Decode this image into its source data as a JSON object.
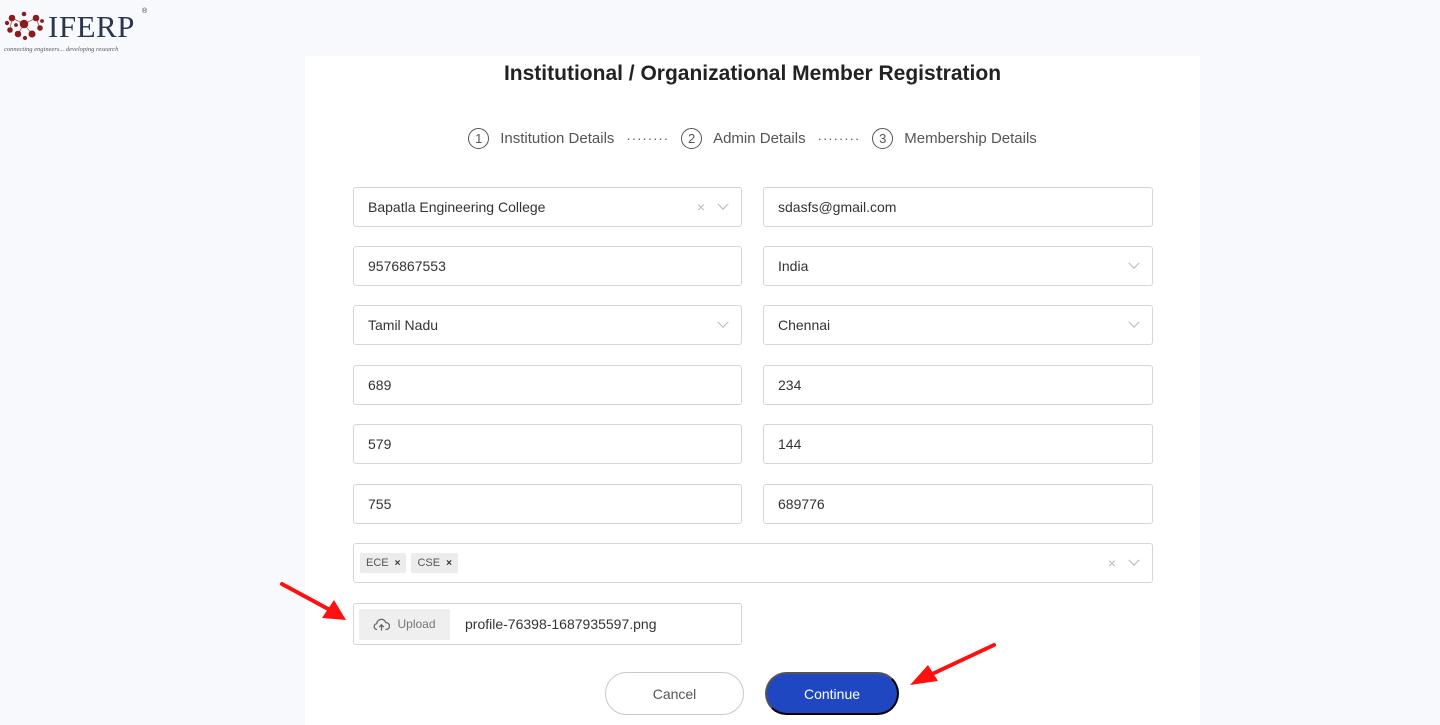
{
  "brand": {
    "name": "IFERP",
    "tagline": "connecting engineers... developing research",
    "registered_mark": "®",
    "colors": {
      "logo_dots": "#8b1c1c",
      "logo_text": "#2a3550"
    }
  },
  "page": {
    "title": "Institutional / Organizational Member Registration"
  },
  "stepper": {
    "steps": [
      {
        "number": "1",
        "label": "Institution Details"
      },
      {
        "number": "2",
        "label": "Admin Details"
      },
      {
        "number": "3",
        "label": "Membership Details"
      }
    ],
    "separator": "········"
  },
  "form": {
    "institution": {
      "value": "Bapatla Engineering College",
      "clear_icon": "×"
    },
    "email": {
      "value": "sdasfs@gmail.com"
    },
    "phone": {
      "value": "9576867553"
    },
    "country": {
      "value": "India"
    },
    "state": {
      "value": "Tamil Nadu"
    },
    "city": {
      "value": "Chennai"
    },
    "field_r4_c1": {
      "value": "689"
    },
    "field_r4_c2": {
      "value": "234"
    },
    "field_r5_c1": {
      "value": "579"
    },
    "field_r5_c2": {
      "value": "144"
    },
    "field_r6_c1": {
      "value": "755"
    },
    "field_r6_c2": {
      "value": "689776"
    },
    "departments": {
      "tags": [
        {
          "label": "ECE",
          "remove": "×"
        },
        {
          "label": "CSE",
          "remove": "×"
        }
      ],
      "clear_icon": "×"
    },
    "upload": {
      "button_label": "Upload",
      "file_name": "profile-76398-1687935597.png"
    }
  },
  "actions": {
    "cancel_label": "Cancel",
    "continue_label": "Continue",
    "colors": {
      "primary": "#2047c2"
    }
  },
  "annotations": {
    "arrow_color": "#ff1010"
  }
}
